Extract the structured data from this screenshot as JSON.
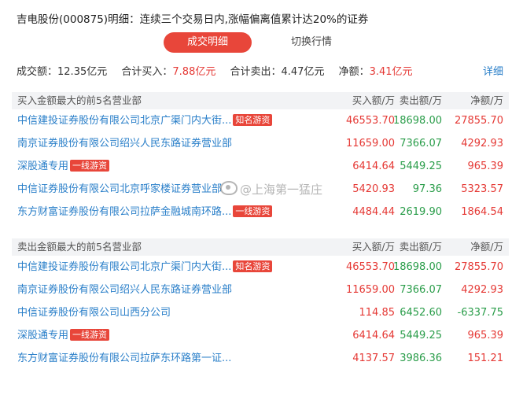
{
  "title": "吉电股份(000875)明细：连续三个交易日内,涨幅偏离值累计达20%的证券",
  "tabs": {
    "active": "成交明细",
    "inactive": "切换行情"
  },
  "summary": {
    "turnover_label": "成交额：",
    "turnover_value": "12.35亿元",
    "buy_label": "合计买入：",
    "buy_value": "7.88亿元",
    "sell_label": "合计卖出：",
    "sell_value": "4.47亿元",
    "net_label": "净额：",
    "net_value": "3.41亿元",
    "detail_link": "详细"
  },
  "buy_section": {
    "header": "买入金额最大的前5名营业部",
    "col_buy": "买入额/万",
    "col_sell": "卖出额/万",
    "col_net": "净额/万",
    "rows": [
      {
        "name": "中信建投证券股份有限公司北京广渠门内大街...",
        "tag": "知名游资",
        "buy": "46553.70",
        "sell": "18698.00",
        "net": "27855.70"
      },
      {
        "name": "南京证券股份有限公司绍兴人民东路证券营业部",
        "tag": "",
        "buy": "11659.00",
        "sell": "7366.07",
        "net": "4292.93"
      },
      {
        "name": "深股通专用",
        "tag": "一线游资",
        "buy": "6414.64",
        "sell": "5449.25",
        "net": "965.39"
      },
      {
        "name": "中信证券股份有限公司北京呼家楼证券营业部",
        "tag": "",
        "buy": "5420.93",
        "sell": "97.36",
        "net": "5323.57"
      },
      {
        "name": "东方财富证券股份有限公司拉萨金融城南环路...",
        "tag": "一线游资",
        "buy": "4484.44",
        "sell": "2619.90",
        "net": "1864.54"
      }
    ]
  },
  "sell_section": {
    "header": "卖出金额最大的前5名营业部",
    "col_buy": "买入额/万",
    "col_sell": "卖出额/万",
    "col_net": "净额/万",
    "rows": [
      {
        "name": "中信建投证券股份有限公司北京广渠门内大街...",
        "tag": "知名游资",
        "buy": "46553.70",
        "sell": "18698.00",
        "net": "27855.70"
      },
      {
        "name": "南京证券股份有限公司绍兴人民东路证券营业部",
        "tag": "",
        "buy": "11659.00",
        "sell": "7366.07",
        "net": "4292.93"
      },
      {
        "name": "中信证券股份有限公司山西分公司",
        "tag": "",
        "buy": "114.85",
        "sell": "6452.60",
        "net": "-6337.75"
      },
      {
        "name": "深股通专用",
        "tag": "一线游资",
        "buy": "6414.64",
        "sell": "5449.25",
        "net": "965.39"
      },
      {
        "name": "东方财富证券股份有限公司拉萨东环路第一证...",
        "tag": "",
        "buy": "4137.57",
        "sell": "3986.36",
        "net": "151.21"
      }
    ]
  },
  "watermark": "@上海第一猛庄",
  "colors": {
    "accent_red": "#e8463a",
    "link_blue": "#2a7fc9",
    "negative_green": "#2a9d4a",
    "header_bg": "#f2f3f5"
  }
}
